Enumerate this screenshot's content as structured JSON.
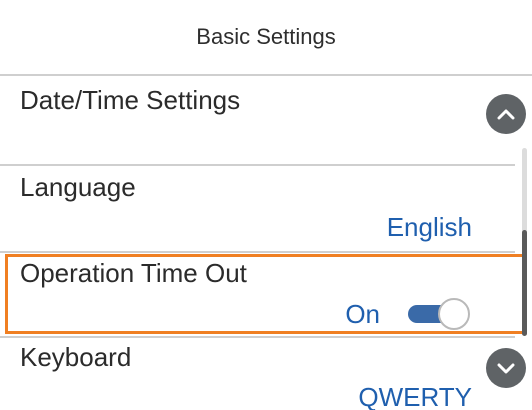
{
  "header": {
    "title": "Basic Settings"
  },
  "settings": {
    "date_time": {
      "label": "Date/Time Settings"
    },
    "language": {
      "label": "Language",
      "value": "English"
    },
    "operation_timeout": {
      "label": "Operation Time Out",
      "value": "On",
      "toggle_on": true
    },
    "keyboard": {
      "label": "Keyboard",
      "value": "QWERTY"
    }
  },
  "controls": {
    "scroll_up_icon": "chevron-up-icon",
    "scroll_down_icon": "chevron-down-icon"
  },
  "colors": {
    "highlight": "#f07f22",
    "value_text": "#1f5fae",
    "toggle_track": "#3a6aa8",
    "scroll_button": "#5f6366"
  }
}
